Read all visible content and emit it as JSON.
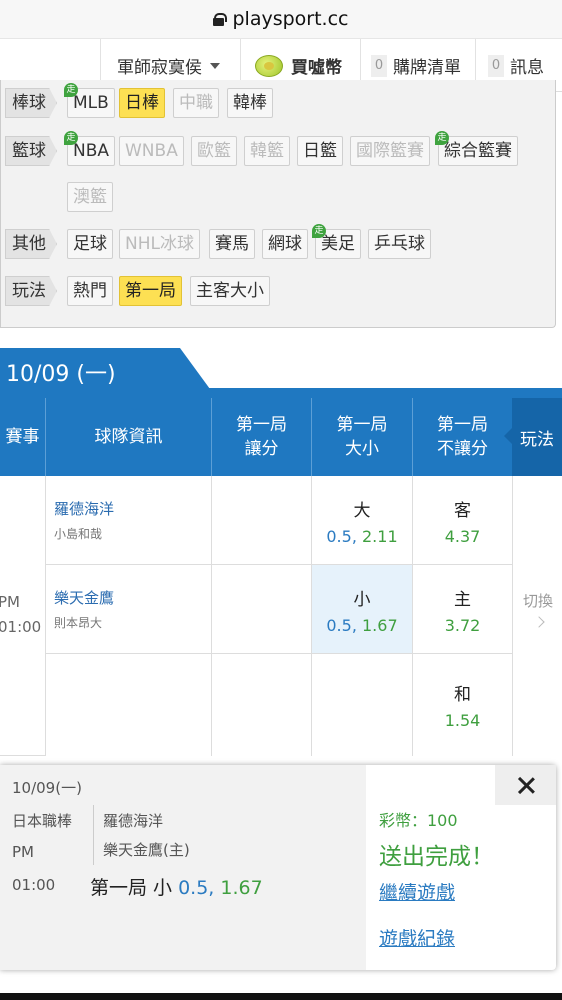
{
  "browser": {
    "url": "playsport.cc"
  },
  "nav": {
    "user": "軍師寂寞侯",
    "buy_coins": "買噓幣",
    "purchase_list_count": "0",
    "purchase_list": "購牌清單",
    "messages_count": "0",
    "messages": "訊息"
  },
  "filters": {
    "rows": [
      {
        "label": "棒球",
        "tags": [
          {
            "text": "MLB",
            "state": "normal",
            "live": true
          },
          {
            "text": "日棒",
            "state": "selected"
          },
          {
            "text": "中職",
            "state": "disabled"
          },
          {
            "text": "韓棒",
            "state": "normal"
          }
        ]
      },
      {
        "label": "籃球",
        "tags": [
          {
            "text": "NBA",
            "state": "normal",
            "live": true
          },
          {
            "text": "WNBA",
            "state": "disabled"
          },
          {
            "text": "歐籃",
            "state": "disabled"
          },
          {
            "text": "韓籃",
            "state": "disabled"
          },
          {
            "text": "日籃",
            "state": "normal"
          },
          {
            "text": "國際籃賽",
            "state": "disabled"
          },
          {
            "text": "綜合籃賽",
            "state": "normal",
            "live": true
          },
          {
            "text": "澳籃",
            "state": "disabled"
          }
        ]
      },
      {
        "label": "其他",
        "tags": [
          {
            "text": "足球",
            "state": "normal"
          },
          {
            "text": "NHL冰球",
            "state": "disabled"
          },
          {
            "text": "賽馬",
            "state": "normal"
          },
          {
            "text": "網球",
            "state": "normal"
          },
          {
            "text": "美足",
            "state": "normal",
            "live": true
          },
          {
            "text": "乒乓球",
            "state": "normal"
          }
        ]
      },
      {
        "label": "玩法",
        "tags": [
          {
            "text": "熱門",
            "state": "normal"
          },
          {
            "text": "第一局",
            "state": "selected"
          },
          {
            "text": "主客大小",
            "state": "normal"
          }
        ]
      }
    ],
    "live_badge": "走"
  },
  "date_header": "10/09 (一)",
  "table": {
    "headers": {
      "event": "賽事",
      "team_info": "球隊資訊",
      "handicap_l1": "第一局",
      "handicap_l2": "讓分",
      "total_l1": "第一局",
      "total_l2": "大小",
      "moneyline_l1": "第一局",
      "moneyline_l2": "不讓分",
      "play": "玩法"
    },
    "game": {
      "time_period": "PM",
      "time": "01:00",
      "away": {
        "team": "羅德海洋",
        "pitcher": "小島和哉"
      },
      "home": {
        "team": "樂天金鷹",
        "pitcher": "則本昂大"
      },
      "over": {
        "label": "大",
        "line": "0.5,",
        "odds": "2.11"
      },
      "under": {
        "label": "小",
        "line": "0.5,",
        "odds": "1.67"
      },
      "away_ml": {
        "label": "客",
        "odds": "4.37"
      },
      "home_ml": {
        "label": "主",
        "odds": "3.72"
      },
      "draw_ml": {
        "label": "和",
        "odds": "1.54"
      },
      "switch": "切換"
    }
  },
  "popup": {
    "date": "10/09(一)",
    "league": "日本職棒",
    "period": "PM",
    "time": "01:00",
    "team1": "羅德海洋",
    "team2": "樂天金鷹(主)",
    "pick_label": "第一局 小",
    "pick_line": "0.5,",
    "pick_odds": "1.67",
    "coins": "彩幣：100",
    "success": "送出完成！",
    "continue": "繼續遊戲",
    "history": "遊戲紀錄"
  },
  "colors": {
    "primary": "#1f78c1",
    "selected": "#fde053",
    "green": "#3f9f3f",
    "link": "#2b7bc1"
  }
}
